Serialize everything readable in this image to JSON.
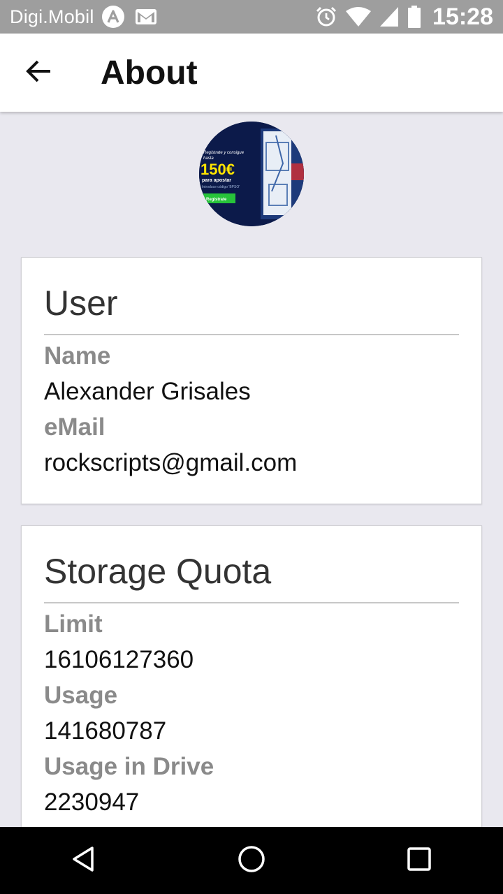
{
  "status_bar": {
    "carrier": "Digi.Mobil",
    "time": "15:28",
    "notification_icons": [
      "arc-app-icon",
      "gmail-icon"
    ],
    "system_icons": [
      "alarm-icon",
      "wifi-icon",
      "signal-icon",
      "battery-icon"
    ]
  },
  "app_bar": {
    "title": "About",
    "back_icon": "arrow-back-icon"
  },
  "avatar": {
    "ad_text": {
      "line1": "Regístrate y consigue",
      "line2": "hasta",
      "amount": "150€",
      "line3": "para apostar",
      "line4": "Introduce código 'BPSO'",
      "button": "Registrate"
    }
  },
  "user_card": {
    "title": "User",
    "name_label": "Name",
    "name_value": "Alexander Grisales",
    "email_label": "eMail",
    "email_value": "rockscripts@gmail.com"
  },
  "storage_card": {
    "title": "Storage Quota",
    "limit_label": "Limit",
    "limit_value": "16106127360",
    "usage_label": "Usage",
    "usage_value": "141680787",
    "usage_drive_label": "Usage in Drive",
    "usage_drive_value": "2230947"
  },
  "nav_bar": {
    "icons": [
      "back-triangle-icon",
      "home-circle-icon",
      "recents-square-icon"
    ]
  },
  "colors": {
    "status_bar": "#9e9e9e",
    "background": "#e9e8ef",
    "label_gray": "#8a8a8a",
    "nav_bar": "#000000"
  }
}
